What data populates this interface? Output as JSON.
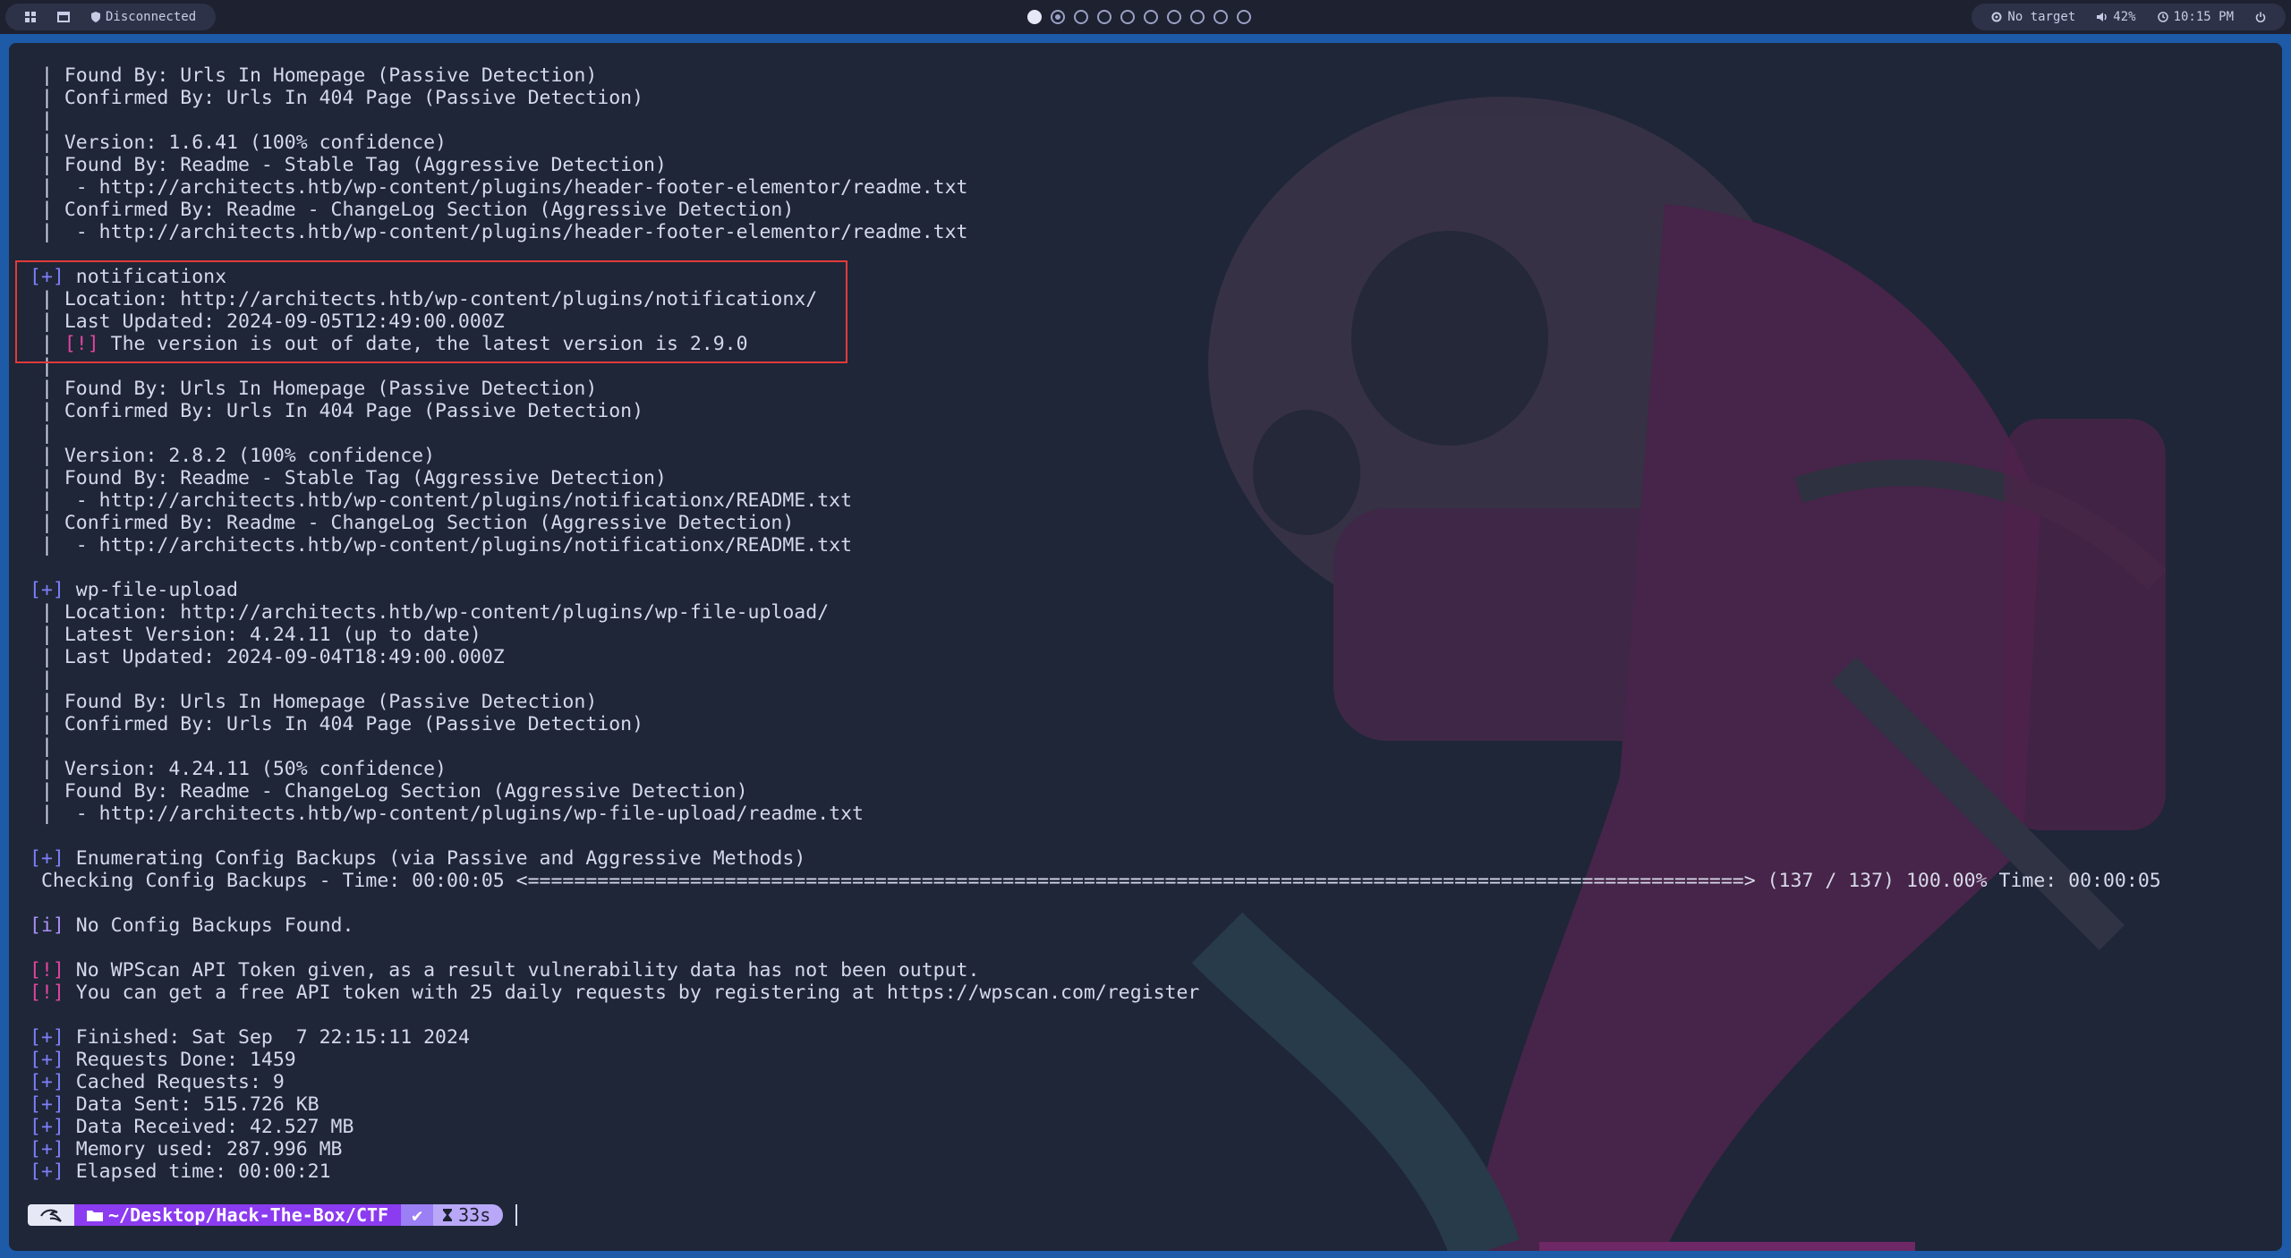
{
  "topbar": {
    "menu_icon": "grid-icon",
    "window_icon": "window-icon",
    "vpn_status": "Disconnected",
    "target": "No target",
    "volume": "42%",
    "clock": "10:15 PM",
    "power_icon": "power-icon",
    "workspaces": 10,
    "active_workspace": 1
  },
  "terminal": {
    "lines": [
      {
        "t": " | Found By: Urls In Homepage (Passive Detection)"
      },
      {
        "t": " | Confirmed By: Urls In 404 Page (Passive Detection)"
      },
      {
        "t": " |"
      },
      {
        "t": " | Version: 1.6.41 (100% confidence)"
      },
      {
        "t": " | Found By: Readme - Stable Tag (Aggressive Detection)"
      },
      {
        "t": " |  - http://architects.htb/wp-content/plugins/header-footer-elementor/readme.txt"
      },
      {
        "t": " | Confirmed By: Readme - ChangeLog Section (Aggressive Detection)"
      },
      {
        "t": " |  - http://architects.htb/wp-content/plugins/header-footer-elementor/readme.txt"
      },
      {
        "t": ""
      },
      {
        "tag": "[+]",
        "kind": "plus",
        "t": " notificationx"
      },
      {
        "t": " | Location: http://architects.htb/wp-content/plugins/notificationx/"
      },
      {
        "t": " | Last Updated: 2024-09-05T12:49:00.000Z"
      },
      {
        "pre": " | ",
        "tag": "[!]",
        "kind": "warn",
        "t": " The version is out of date, the latest version is 2.9.0"
      },
      {
        "t": " |"
      },
      {
        "t": " | Found By: Urls In Homepage (Passive Detection)"
      },
      {
        "t": " | Confirmed By: Urls In 404 Page (Passive Detection)"
      },
      {
        "t": " |"
      },
      {
        "t": " | Version: 2.8.2 (100% confidence)"
      },
      {
        "t": " | Found By: Readme - Stable Tag (Aggressive Detection)"
      },
      {
        "t": " |  - http://architects.htb/wp-content/plugins/notificationx/README.txt"
      },
      {
        "t": " | Confirmed By: Readme - ChangeLog Section (Aggressive Detection)"
      },
      {
        "t": " |  - http://architects.htb/wp-content/plugins/notificationx/README.txt"
      },
      {
        "t": ""
      },
      {
        "tag": "[+]",
        "kind": "plus",
        "t": " wp-file-upload"
      },
      {
        "t": " | Location: http://architects.htb/wp-content/plugins/wp-file-upload/"
      },
      {
        "t": " | Latest Version: 4.24.11 (up to date)"
      },
      {
        "t": " | Last Updated: 2024-09-04T18:49:00.000Z"
      },
      {
        "t": " |"
      },
      {
        "t": " | Found By: Urls In Homepage (Passive Detection)"
      },
      {
        "t": " | Confirmed By: Urls In 404 Page (Passive Detection)"
      },
      {
        "t": " |"
      },
      {
        "t": " | Version: 4.24.11 (50% confidence)"
      },
      {
        "t": " | Found By: Readme - ChangeLog Section (Aggressive Detection)"
      },
      {
        "t": " |  - http://architects.htb/wp-content/plugins/wp-file-upload/readme.txt"
      },
      {
        "t": ""
      },
      {
        "tag": "[+]",
        "kind": "plus",
        "t": " Enumerating Config Backups (via Passive and Aggressive Methods)"
      },
      {
        "t": " Checking Config Backups - Time: 00:00:05 <=========================================================================================================> (137 / 137) 100.00% Time: 00:00:05"
      },
      {
        "t": ""
      },
      {
        "tag": "[i]",
        "kind": "info",
        "t": " No Config Backups Found."
      },
      {
        "t": ""
      },
      {
        "tag": "[!]",
        "kind": "warn",
        "t": " No WPScan API Token given, as a result vulnerability data has not been output."
      },
      {
        "tag": "[!]",
        "kind": "warn",
        "t": " You can get a free API token with 25 daily requests by registering at https://wpscan.com/register"
      },
      {
        "t": ""
      },
      {
        "tag": "[+]",
        "kind": "plus",
        "t": " Finished: Sat Sep  7 22:15:11 2024"
      },
      {
        "tag": "[+]",
        "kind": "plus",
        "t": " Requests Done: 1459"
      },
      {
        "tag": "[+]",
        "kind": "plus",
        "t": " Cached Requests: 9"
      },
      {
        "tag": "[+]",
        "kind": "plus",
        "t": " Data Sent: 515.726 KB"
      },
      {
        "tag": "[+]",
        "kind": "plus",
        "t": " Data Received: 42.527 MB"
      },
      {
        "tag": "[+]",
        "kind": "plus",
        "t": " Memory used: 287.996 MB"
      },
      {
        "tag": "[+]",
        "kind": "plus",
        "t": " Elapsed time: 00:00:21"
      }
    ]
  },
  "prompt": {
    "os_icon": "kali-dragon-icon",
    "folder_icon": "folder-icon",
    "path": "~/Desktop/Hack-The-Box/",
    "path_current": "CTF",
    "status": "✔",
    "timer_icon": "hourglass-icon",
    "duration": "33s"
  },
  "colors": {
    "plus_tag": "#7e7ff8",
    "warn_tag": "#e0469c",
    "info_tag": "#a98ff5",
    "highlight_box": "#e23a3a",
    "terminal_bg": "#1e2638",
    "prompt_dir": "#8b3bf0"
  }
}
